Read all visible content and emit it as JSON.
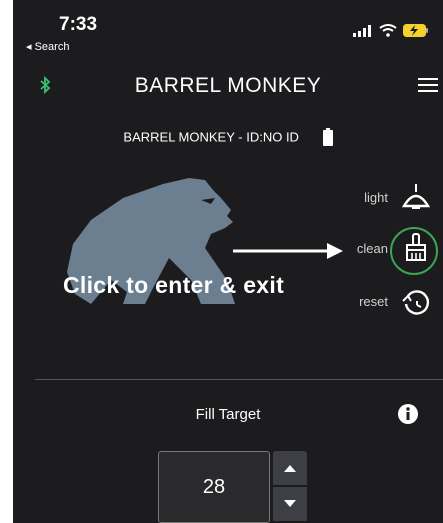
{
  "status_bar": {
    "time": "7:33",
    "back_label": "◂ Search"
  },
  "header": {
    "title": "BARREL MONKEY"
  },
  "device": {
    "label": "BARREL MONKEY - ID:NO ID"
  },
  "controls": {
    "light_label": "light",
    "clean_label": "clean",
    "reset_label": "reset"
  },
  "annotation": {
    "hint_text": "Click to enter & exit"
  },
  "fill_target": {
    "label": "Fill Target",
    "value": "28"
  },
  "colors": {
    "background": "#1c1c1e",
    "gorilla": "#6b7f91",
    "bluetooth": "#38c172",
    "highlight": "#3aa655"
  },
  "icons": [
    "signal-icon",
    "wifi-icon",
    "battery-charging-icon",
    "bluetooth-icon",
    "menu-icon",
    "battery-icon",
    "gorilla-logo",
    "light-icon",
    "clean-brush-icon",
    "reset-icon",
    "arrow-right-icon",
    "info-icon",
    "chevron-up-icon",
    "chevron-down-icon"
  ]
}
